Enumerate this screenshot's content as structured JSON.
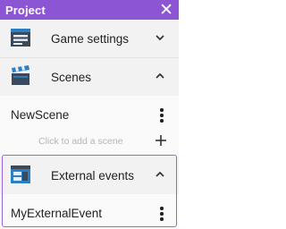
{
  "window": {
    "title": "Project",
    "close_icon": "close-icon"
  },
  "sections": {
    "game_settings": {
      "label": "Game settings",
      "icon": "game-settings-icon",
      "chevron": "chevron-down"
    },
    "scenes": {
      "label": "Scenes",
      "icon": "scenes-clapperboard-icon",
      "chevron": "chevron-up"
    },
    "external_events": {
      "label": "External events",
      "icon": "external-events-icon",
      "chevron": "chevron-up"
    }
  },
  "scenes_list": {
    "items": [
      {
        "label": "NewScene"
      }
    ],
    "add_label": "Click to add a scene"
  },
  "external_events_list": {
    "items": [
      {
        "label": "MyExternalEvent"
      }
    ]
  },
  "colors": {
    "accent": "#8b55d4",
    "selection_border": "#9a64e0",
    "icon_blue": "#2b7fc4",
    "icon_dark": "#3b4a5a"
  }
}
